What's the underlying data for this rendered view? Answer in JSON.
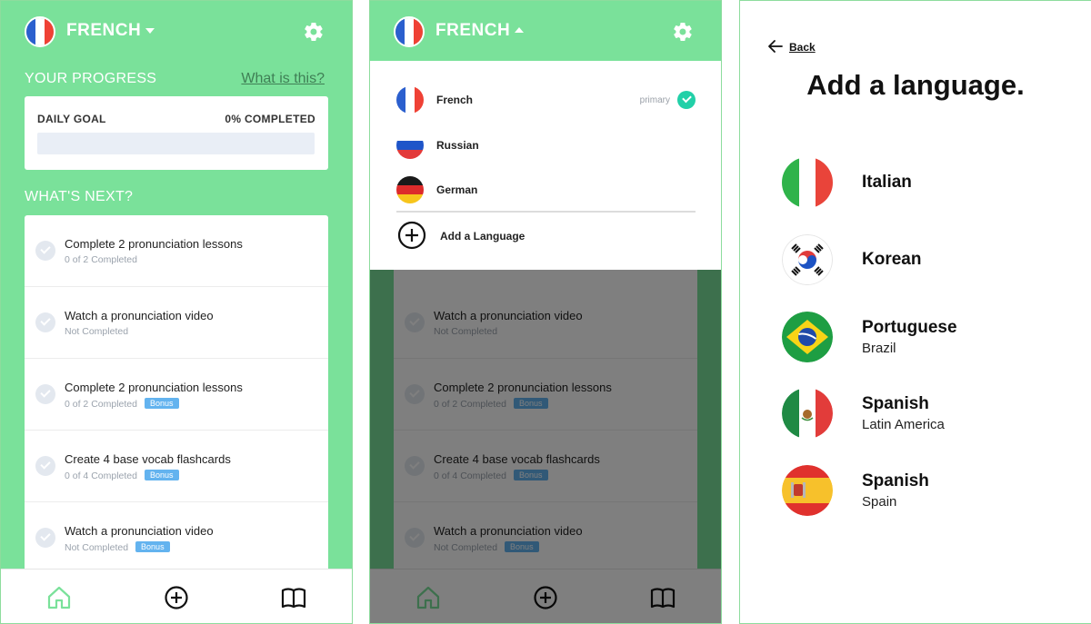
{
  "home": {
    "language": "FRENCH",
    "progress_label": "YOUR PROGRESS",
    "what_link": "What is this?",
    "daily_goal_label": "DAILY GOAL",
    "daily_goal_status": "0% COMPLETED",
    "daily_goal_progress": 0,
    "whats_next_label": "WHAT'S NEXT?",
    "tasks": [
      {
        "title": "Complete 2 pronunciation lessons",
        "sub": "0 of 2 Completed",
        "bonus": ""
      },
      {
        "title": "Watch a pronunciation video",
        "sub": "Not Completed",
        "bonus": ""
      },
      {
        "title": "Complete 2 pronunciation lessons",
        "sub": "0 of 2 Completed",
        "bonus": "Bonus"
      },
      {
        "title": "Create 4 base vocab flashcards",
        "sub": "0 of 4 Completed",
        "bonus": "Bonus"
      },
      {
        "title": "Watch a pronunciation video",
        "sub": "Not Completed",
        "bonus": "Bonus"
      }
    ],
    "nav": [
      "home-icon",
      "add-circle-icon",
      "book-icon"
    ]
  },
  "switcher": {
    "language": "FRENCH",
    "languages": [
      {
        "name": "French",
        "badge": "primary",
        "flag": "france-flag-icon"
      },
      {
        "name": "Russian",
        "badge": "",
        "flag": "russia-flag-icon"
      },
      {
        "name": "German",
        "badge": "",
        "flag": "germany-flag-icon"
      }
    ],
    "add_label": "Add a Language",
    "tasks": [
      {
        "title": "Watch a pronunciation video",
        "sub": "Not Completed",
        "bonus": ""
      },
      {
        "title": "Complete 2 pronunciation lessons",
        "sub": "0 of 2 Completed",
        "bonus": "Bonus"
      },
      {
        "title": "Create 4 base vocab flashcards",
        "sub": "0 of 4 Completed",
        "bonus": "Bonus"
      },
      {
        "title": "Watch a pronunciation video",
        "sub": "Not Completed",
        "bonus": "Bonus"
      }
    ]
  },
  "add_language": {
    "back_label": "Back",
    "title": "Add a language.",
    "languages": [
      {
        "name": "Italian",
        "sub": "",
        "flag": "italy-flag-icon"
      },
      {
        "name": "Korean",
        "sub": "",
        "flag": "korea-flag-icon"
      },
      {
        "name": "Portuguese",
        "sub": "Brazil",
        "flag": "brazil-flag-icon"
      },
      {
        "name": "Spanish",
        "sub": "Latin America",
        "flag": "mexico-flag-icon"
      },
      {
        "name": "Spanish",
        "sub": "Spain",
        "flag": "spain-flag-icon"
      }
    ]
  },
  "colors": {
    "brand_green": "#7ae19a",
    "bonus_blue": "#63b3ef",
    "primary_check": "#22d0a8"
  }
}
